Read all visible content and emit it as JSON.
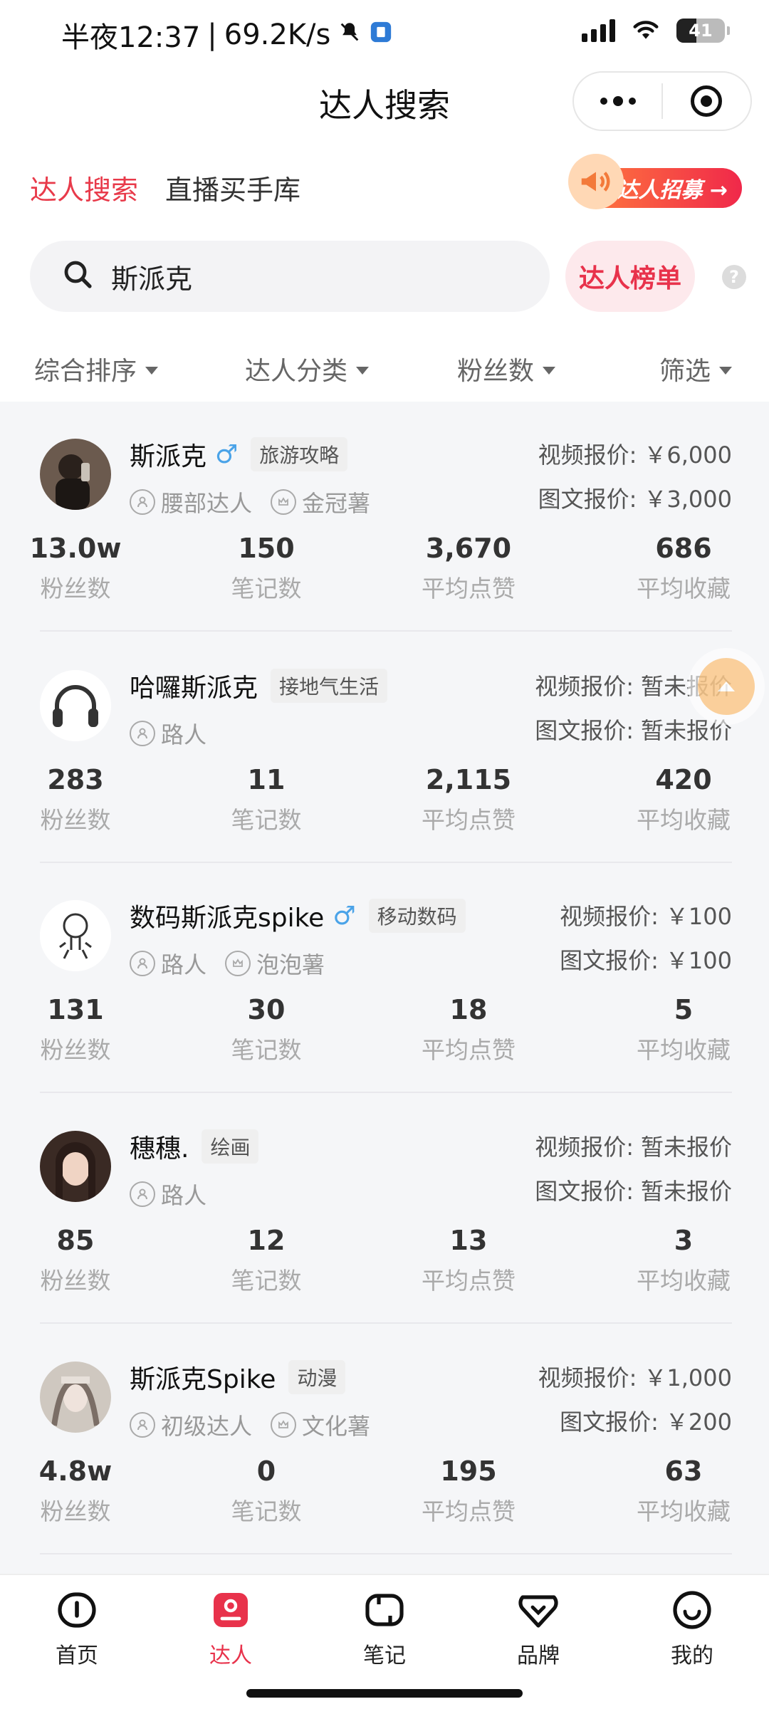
{
  "status": {
    "time": "半夜12:37",
    "speed": "69.2K/s",
    "battery": "41",
    "battery_level": 0.41
  },
  "nav": {
    "title": "达人搜索"
  },
  "tabs": {
    "active": "达人搜索",
    "inactive": "直播买手库"
  },
  "recruit": {
    "label": "达人招募 →"
  },
  "search": {
    "value": "斯派克",
    "rank_label": "达人榜单",
    "help": "?"
  },
  "filters": [
    "综合排序",
    "达人分类",
    "粉丝数",
    "筛选"
  ],
  "stat_labels": {
    "fans": "粉丝数",
    "notes": "笔记数",
    "likes": "平均点赞",
    "saves": "平均收藏"
  },
  "price_labels": {
    "video": "视频报价:",
    "image": "图文报价:"
  },
  "creators": [
    {
      "name": "斯派克",
      "gender": "♂",
      "category": "旅游攻略",
      "level": "腰部达人",
      "rank": "金冠薯",
      "video_price": "￥6,000",
      "image_price": "￥3,000",
      "fans": "13.0w",
      "notes": "150",
      "likes": "3,670",
      "saves": "686"
    },
    {
      "name": "哈囉斯派克",
      "gender": "",
      "category": "接地气生活",
      "level": "路人",
      "rank": "",
      "video_price": "暂未报价",
      "image_price": "暂未报价",
      "fans": "283",
      "notes": "11",
      "likes": "2,115",
      "saves": "420"
    },
    {
      "name": "数码斯派克spike",
      "gender": "♂",
      "category": "移动数码",
      "level": "路人",
      "rank": "泡泡薯",
      "video_price": "￥100",
      "image_price": "￥100",
      "fans": "131",
      "notes": "30",
      "likes": "18",
      "saves": "5"
    },
    {
      "name": "穗穗.",
      "gender": "",
      "category": "绘画",
      "level": "路人",
      "rank": "",
      "video_price": "暂未报价",
      "image_price": "暂未报价",
      "fans": "85",
      "notes": "12",
      "likes": "13",
      "saves": "3"
    },
    {
      "name": "斯派克Spike",
      "gender": "",
      "category": "动漫",
      "level": "初级达人",
      "rank": "文化薯",
      "video_price": "￥1,000",
      "image_price": "￥200",
      "fans": "4.8w",
      "notes": "0",
      "likes": "195",
      "saves": "63"
    }
  ],
  "tabbar": [
    {
      "label": "首页",
      "icon": "home-icon"
    },
    {
      "label": "达人",
      "icon": "creator-icon"
    },
    {
      "label": "笔记",
      "icon": "note-icon"
    },
    {
      "label": "品牌",
      "icon": "brand-icon"
    },
    {
      "label": "我的",
      "icon": "profile-icon"
    }
  ],
  "colors": {
    "accent": "#e8324b",
    "tab_active": "#e83a4a"
  }
}
